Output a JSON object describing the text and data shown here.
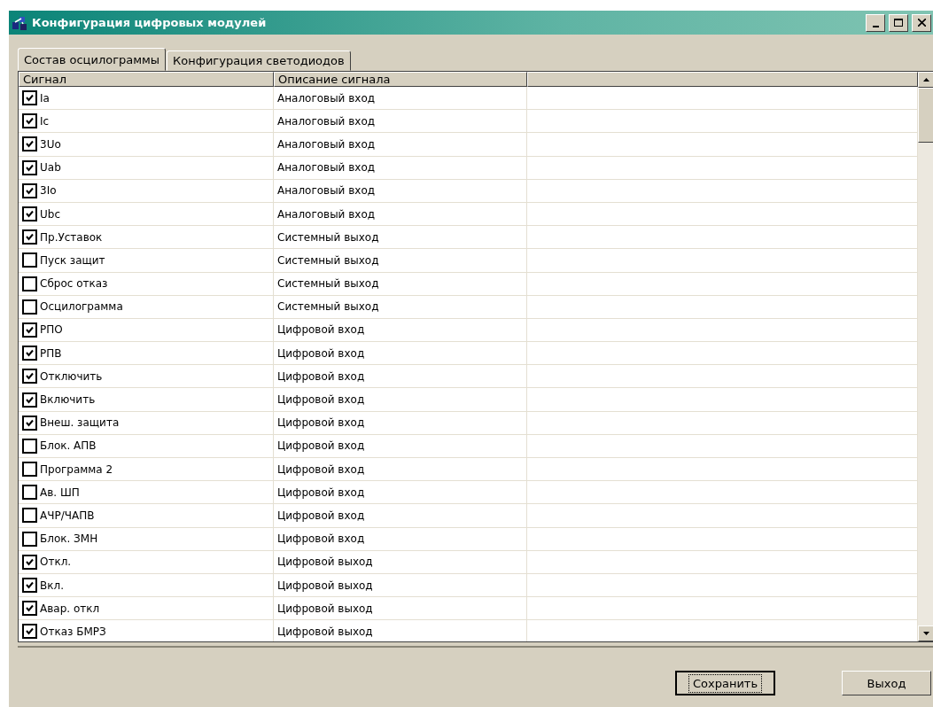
{
  "window": {
    "title": "Конфигурация цифровых модулей"
  },
  "tabs": [
    {
      "label": "Состав осцилограммы",
      "selected": true
    },
    {
      "label": "Конфигурация светодиодов",
      "selected": false
    }
  ],
  "table": {
    "columns": [
      "Сигнал",
      "Описание сигнала"
    ],
    "rows": [
      {
        "signal": "Ia",
        "description": "Аналоговый вход",
        "checked": true
      },
      {
        "signal": "Ic",
        "description": "Аналоговый вход",
        "checked": true
      },
      {
        "signal": "3Uo",
        "description": "Аналоговый вход",
        "checked": true
      },
      {
        "signal": "Uab",
        "description": "Аналоговый вход",
        "checked": true
      },
      {
        "signal": "3Io",
        "description": "Аналоговый вход",
        "checked": true
      },
      {
        "signal": "Ubc",
        "description": "Аналоговый вход",
        "checked": true
      },
      {
        "signal": "Пр.Уставок",
        "description": "Системный выход",
        "checked": true
      },
      {
        "signal": "Пуск защит",
        "description": "Системный выход",
        "checked": false
      },
      {
        "signal": "Сброс отказ",
        "description": "Системный выход",
        "checked": false
      },
      {
        "signal": "Осцилограмма",
        "description": "Системный выход",
        "checked": false
      },
      {
        "signal": "РПО",
        "description": "Цифровой вход",
        "checked": true
      },
      {
        "signal": "РПВ",
        "description": "Цифровой вход",
        "checked": true
      },
      {
        "signal": "Отключить",
        "description": "Цифровой вход",
        "checked": true
      },
      {
        "signal": "Включить",
        "description": "Цифровой вход",
        "checked": true
      },
      {
        "signal": "Внеш. защита",
        "description": "Цифровой вход",
        "checked": true
      },
      {
        "signal": "Блок. АПВ",
        "description": "Цифровой вход",
        "checked": false
      },
      {
        "signal": "Программа 2",
        "description": "Цифровой вход",
        "checked": false
      },
      {
        "signal": "Ав. ШП",
        "description": "Цифровой вход",
        "checked": false
      },
      {
        "signal": "АЧР/ЧАПВ",
        "description": "Цифровой вход",
        "checked": false
      },
      {
        "signal": "Блок. ЗМН",
        "description": "Цифровой вход",
        "checked": false
      },
      {
        "signal": "Откл.",
        "description": "Цифровой выход",
        "checked": true
      },
      {
        "signal": "Вкл.",
        "description": "Цифровой выход",
        "checked": true
      },
      {
        "signal": "Авар. откл",
        "description": "Цифровой выход",
        "checked": true
      },
      {
        "signal": "Отказ БМРЗ",
        "description": "Цифровой выход",
        "checked": true
      }
    ]
  },
  "buttons": [
    {
      "label": "Сохранить",
      "focused": true
    },
    {
      "label": "Выход",
      "focused": false
    }
  ]
}
